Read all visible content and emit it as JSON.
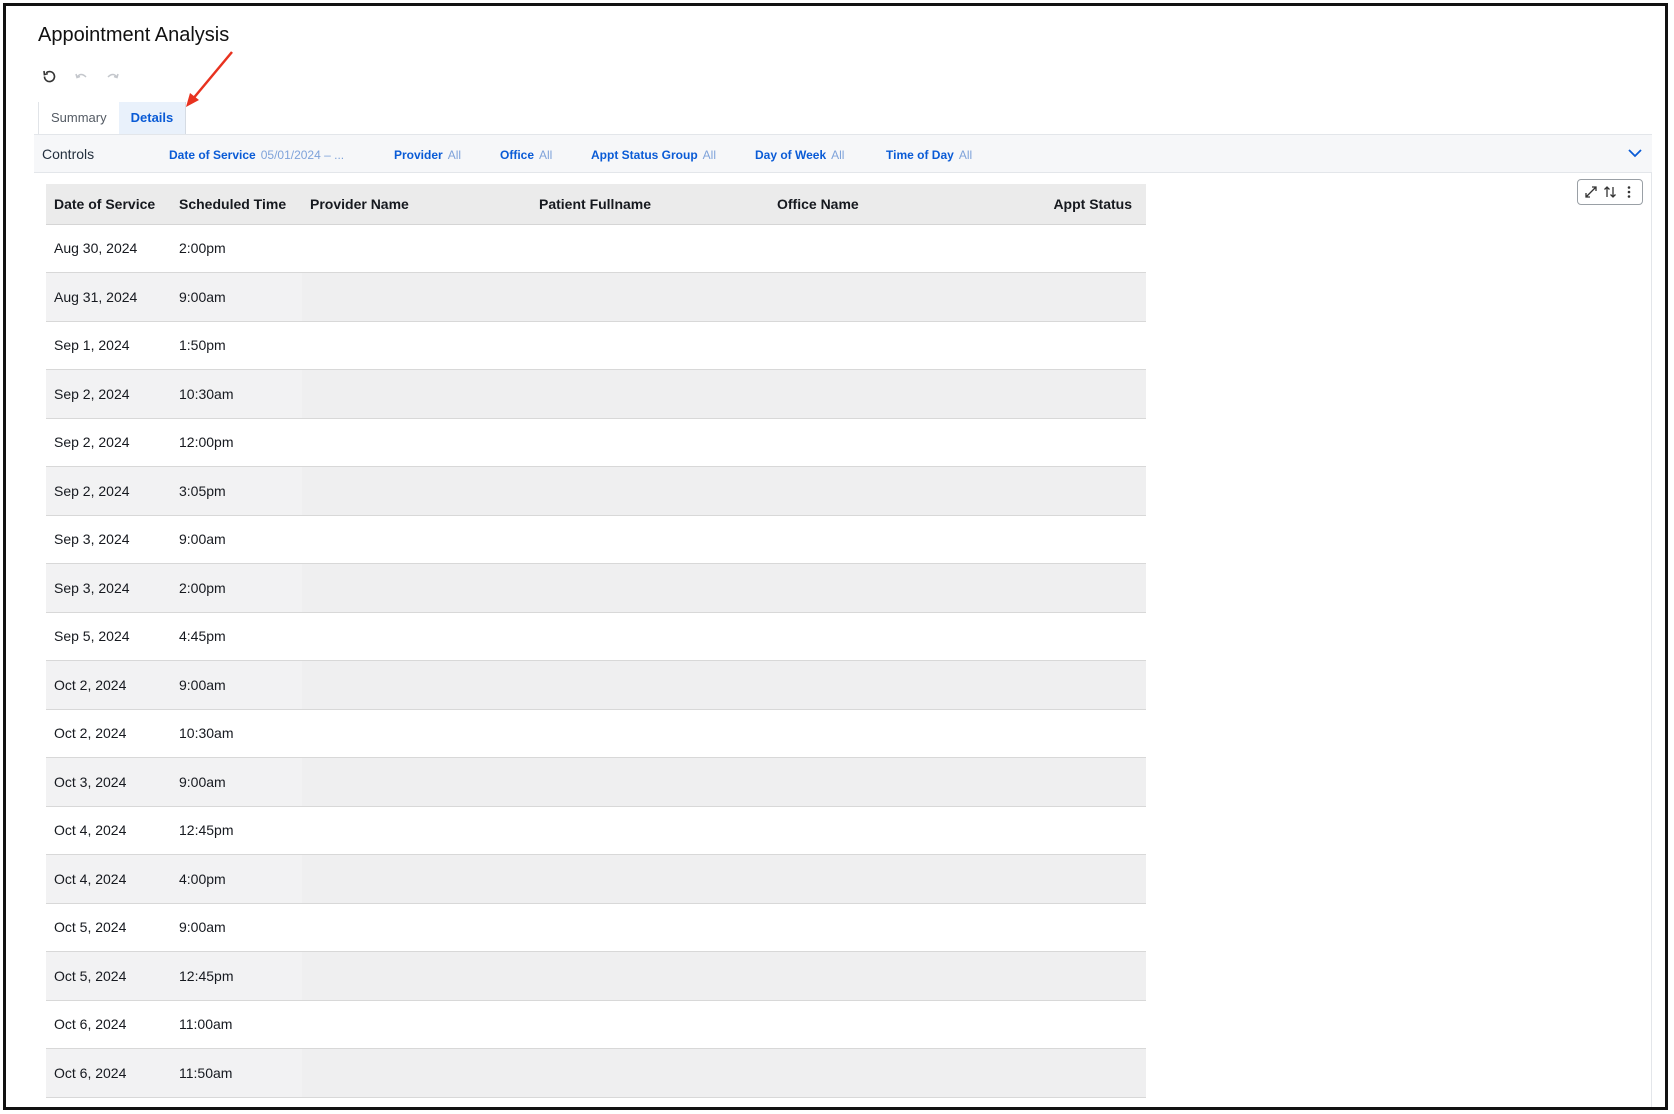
{
  "app": {
    "title": "Appointment Analysis"
  },
  "toolbar": {
    "reset_icon": "reset-icon",
    "undo_icon": "undo-icon",
    "redo_icon": "redo-icon"
  },
  "tabs": [
    {
      "label": "Summary",
      "active": false
    },
    {
      "label": "Details",
      "active": true
    }
  ],
  "controls": {
    "label": "Controls",
    "items": [
      {
        "name": "Date of Service",
        "value": "05/01/2024 – ..."
      },
      {
        "name": "Provider",
        "value": "All"
      },
      {
        "name": "Office",
        "value": "All"
      },
      {
        "name": "Appt Status Group",
        "value": "All"
      },
      {
        "name": "Day of Week",
        "value": "All"
      },
      {
        "name": "Time of Day",
        "value": "All"
      }
    ]
  },
  "visual_menu": {
    "icons": [
      "expand-icon",
      "sort-icon",
      "more-options-icon"
    ]
  },
  "table": {
    "columns": [
      "Date of Service",
      "Scheduled Time",
      "Provider Name",
      "Patient Fullname",
      "Office Name",
      "Appt Status"
    ],
    "rows": [
      [
        "Aug 30, 2024",
        "2:00pm",
        "",
        "",
        "",
        ""
      ],
      [
        "Aug 31, 2024",
        "9:00am",
        "",
        "",
        "",
        ""
      ],
      [
        "Sep 1, 2024",
        "1:50pm",
        "",
        "",
        "",
        ""
      ],
      [
        "Sep 2, 2024",
        "10:30am",
        "",
        "",
        "",
        ""
      ],
      [
        "Sep 2, 2024",
        "12:00pm",
        "",
        "",
        "",
        ""
      ],
      [
        "Sep 2, 2024",
        "3:05pm",
        "",
        "",
        "",
        ""
      ],
      [
        "Sep 3, 2024",
        "9:00am",
        "",
        "",
        "",
        ""
      ],
      [
        "Sep 3, 2024",
        "2:00pm",
        "",
        "",
        "",
        ""
      ],
      [
        "Sep 5, 2024",
        "4:45pm",
        "",
        "",
        "",
        ""
      ],
      [
        "Oct 2, 2024",
        "9:00am",
        "",
        "",
        "",
        ""
      ],
      [
        "Oct 2, 2024",
        "10:30am",
        "",
        "",
        "",
        ""
      ],
      [
        "Oct 3, 2024",
        "9:00am",
        "",
        "",
        "",
        ""
      ],
      [
        "Oct 4, 2024",
        "12:45pm",
        "",
        "",
        "",
        ""
      ],
      [
        "Oct 4, 2024",
        "4:00pm",
        "",
        "",
        "",
        ""
      ],
      [
        "Oct 5, 2024",
        "9:00am",
        "",
        "",
        "",
        ""
      ],
      [
        "Oct 5, 2024",
        "12:45pm",
        "",
        "",
        "",
        ""
      ],
      [
        "Oct 6, 2024",
        "11:00am",
        "",
        "",
        "",
        ""
      ],
      [
        "Oct 6, 2024",
        "11:50am",
        "",
        "",
        "",
        ""
      ]
    ]
  },
  "colors": {
    "accent": "#0a5bd6",
    "annotation_arrow": "#e8321f"
  }
}
